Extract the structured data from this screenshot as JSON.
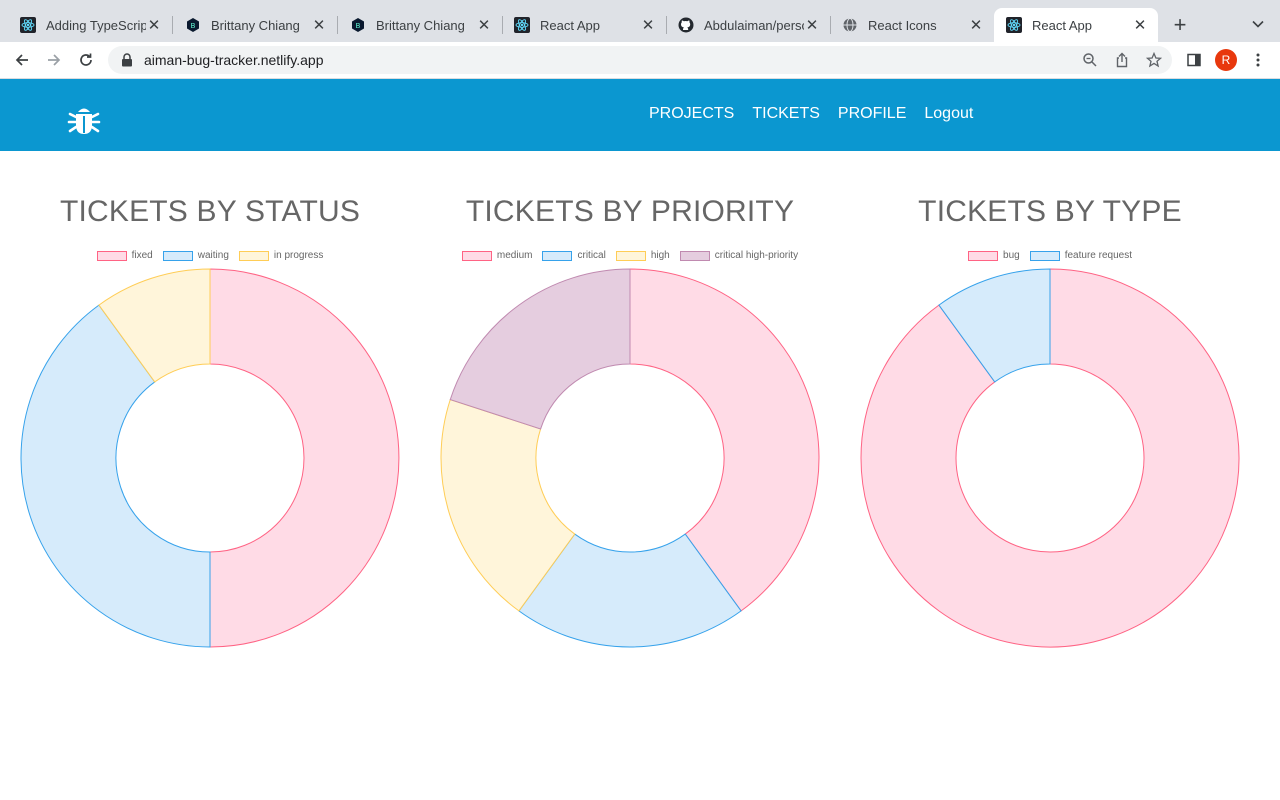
{
  "browser": {
    "tabs": [
      {
        "title": "Adding TypeScript",
        "icon": "react-icon"
      },
      {
        "title": "Brittany Chiang",
        "icon": "hexagon-b-icon"
      },
      {
        "title": "Brittany Chiang",
        "icon": "hexagon-b-icon"
      },
      {
        "title": "React App",
        "icon": "react-icon"
      },
      {
        "title": "Abdulaiman/personal",
        "icon": "github-icon"
      },
      {
        "title": "React Icons",
        "icon": "globe-icon"
      },
      {
        "title": "React App",
        "icon": "react-icon",
        "active": true
      }
    ],
    "url": "aiman-bug-tracker.netlify.app",
    "profile_initial": "R"
  },
  "app": {
    "brand_color": "#0b97d0",
    "logo_icon": "bug-icon",
    "nav": [
      "PROJECTS",
      "TICKETS",
      "PROFILE",
      "Logout"
    ]
  },
  "chart_data": [
    {
      "type": "doughnut",
      "title": "TICKETS BY STATUS",
      "legend_position": "top",
      "categories": [
        "fixed",
        "waiting",
        "in progress"
      ],
      "values": [
        5,
        4,
        1
      ],
      "colors": [
        {
          "fill": "#ffdbe6",
          "stroke": "#ff6384"
        },
        {
          "fill": "#d6ebfb",
          "stroke": "#36a2eb"
        },
        {
          "fill": "#fff5da",
          "stroke": "#ffcd56"
        }
      ]
    },
    {
      "type": "doughnut",
      "title": "TICKETS BY PRIORITY",
      "legend_position": "top",
      "categories": [
        "medium",
        "critical",
        "high",
        "critical high-priority"
      ],
      "values": [
        4,
        2,
        2,
        2
      ],
      "colors": [
        {
          "fill": "#ffdbe6",
          "stroke": "#ff6384"
        },
        {
          "fill": "#d6ebfb",
          "stroke": "#36a2eb"
        },
        {
          "fill": "#fff5da",
          "stroke": "#ffcd56"
        },
        {
          "fill": "#e5cddf",
          "stroke": "#c08ab0"
        }
      ]
    },
    {
      "type": "doughnut",
      "title": "TICKETS BY TYPE",
      "legend_position": "top",
      "categories": [
        "bug",
        "feature request"
      ],
      "values": [
        9,
        1
      ],
      "colors": [
        {
          "fill": "#ffdbe6",
          "stroke": "#ff6384"
        },
        {
          "fill": "#d6ebfb",
          "stroke": "#36a2eb"
        }
      ]
    }
  ]
}
